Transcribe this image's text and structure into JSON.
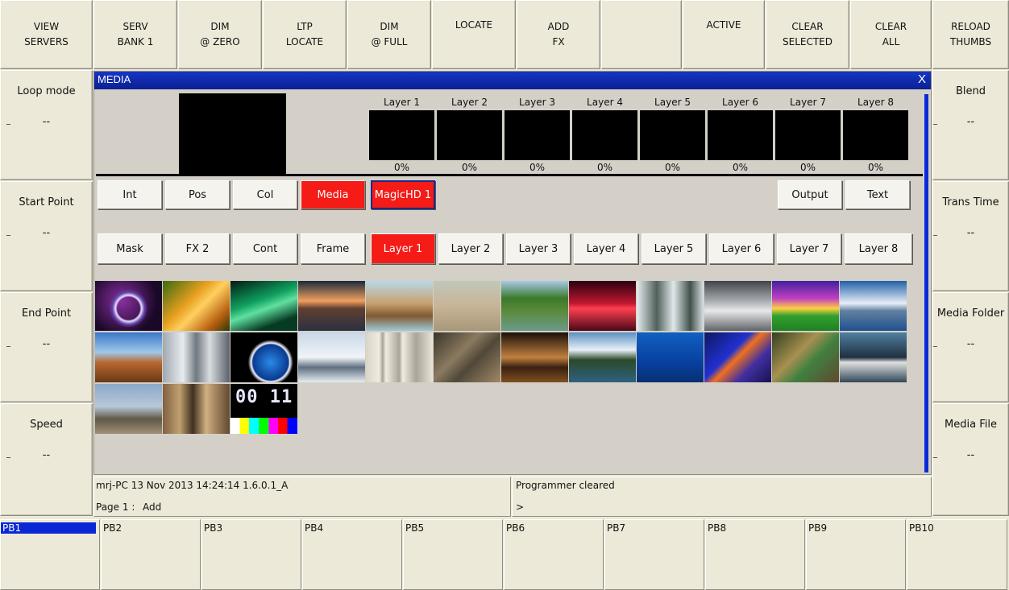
{
  "top_buttons": [
    {
      "line1": "VIEW",
      "line2": "SERVERS"
    },
    {
      "line1": "SERV",
      "line2": "BANK 1"
    },
    {
      "line1": "DIM",
      "line2": "@ ZERO"
    },
    {
      "line1": "LTP",
      "line2": "LOCATE"
    },
    {
      "line1": "DIM",
      "line2": "@ FULL"
    },
    {
      "line1": "LOCATE",
      "line2": ""
    },
    {
      "line1": "ADD",
      "line2": "FX"
    },
    {
      "line1": "",
      "line2": ""
    },
    {
      "line1": "ACTIVE",
      "line2": ""
    },
    {
      "line1": "CLEAR",
      "line2": "SELECTED"
    },
    {
      "line1": "CLEAR",
      "line2": "ALL"
    },
    {
      "line1": "RELOAD",
      "line2": "THUMBS"
    }
  ],
  "left_panel": [
    {
      "label": "Loop mode",
      "value": "--"
    },
    {
      "label": "Start Point",
      "value": "--"
    },
    {
      "label": "End Point",
      "value": "--"
    },
    {
      "label": "Speed",
      "value": "--"
    }
  ],
  "right_panel": [
    {
      "label": "Blend",
      "value": "--"
    },
    {
      "label": "Trans Time",
      "value": "--"
    },
    {
      "label": "Media Folder",
      "value": "--"
    },
    {
      "label": "Media File",
      "value": "--"
    }
  ],
  "media_window": {
    "title": "MEDIA",
    "close": "X",
    "layers": [
      {
        "name": "Layer 1",
        "level": "0%"
      },
      {
        "name": "Layer 2",
        "level": "0%"
      },
      {
        "name": "Layer 3",
        "level": "0%"
      },
      {
        "name": "Layer 4",
        "level": "0%"
      },
      {
        "name": "Layer 5",
        "level": "0%"
      },
      {
        "name": "Layer 6",
        "level": "0%"
      },
      {
        "name": "Layer 7",
        "level": "0%"
      },
      {
        "name": "Layer 8",
        "level": "0%"
      }
    ],
    "attr_row1": [
      "Int",
      "Pos",
      "Col",
      "Media"
    ],
    "attr_row2": [
      "Mask",
      "FX 2",
      "Cont",
      "Frame"
    ],
    "server_tab": "MagicHD 1",
    "output_label": "Output",
    "text_label": "Text",
    "layer_tabs": [
      "Layer 1",
      "Layer 2",
      "Layer 3",
      "Layer 4",
      "Layer 5",
      "Layer 6",
      "Layer 7",
      "Layer 8"
    ],
    "thumbnails": [
      "ring",
      "orange-swirl",
      "green-aurora",
      "dusk-shore",
      "sea-rocks",
      "sand",
      "green-lake",
      "red-sunset",
      "snowy-forest",
      "clouds",
      "purple-sky",
      "alpine-sky",
      "desert-rocks",
      "skyscraper",
      "earth-globe",
      "snow-river",
      "classic-building",
      "city-aerial",
      "city-night",
      "lake-mountain",
      "underwater",
      "clownfish",
      "reef",
      "speedboat",
      "airplane",
      "crowd",
      "test-card"
    ],
    "test_card_digits": "00 11"
  },
  "status": {
    "info": "mrj-PC 13 Nov 2013 14:24:14 1.6.0.1_A",
    "page_label": "Page 1 :",
    "page_mode": "Add",
    "message": "Programmer cleared",
    "prompt": ">"
  },
  "playbacks": [
    "PB1",
    "PB2",
    "PB3",
    "PB4",
    "PB5",
    "PB6",
    "PB7",
    "PB8",
    "PB9",
    "PB10"
  ],
  "colors": {
    "accent_red": "#f51b17",
    "title_blue": "#0a2092",
    "select_blue": "#0b28d6"
  }
}
